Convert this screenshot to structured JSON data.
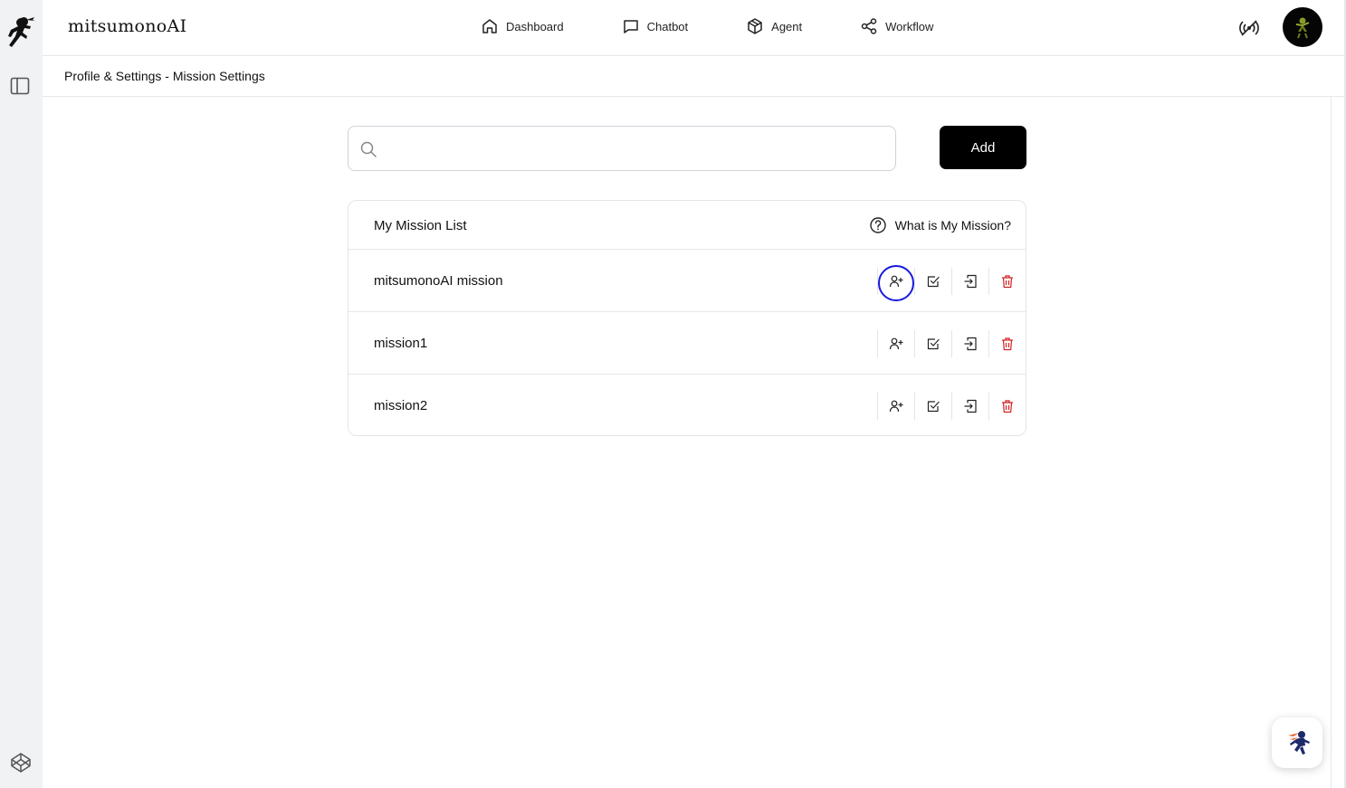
{
  "app": {
    "brand": "mitsumonoAI"
  },
  "nav": {
    "items": [
      {
        "label": "Dashboard",
        "icon": "home-icon"
      },
      {
        "label": "Chatbot",
        "icon": "chat-bubble-icon"
      },
      {
        "label": "Agent",
        "icon": "cube-icon"
      },
      {
        "label": "Workflow",
        "icon": "share-nodes-icon"
      }
    ]
  },
  "breadcrumb": {
    "text": "Profile & Settings - Mission Settings"
  },
  "search": {
    "value": "",
    "placeholder": ""
  },
  "toolbar": {
    "add_label": "Add"
  },
  "mission_list": {
    "title": "My Mission List",
    "help_label": "What is My Mission?",
    "rows": [
      {
        "name": "mitsumonoAI mission"
      },
      {
        "name": "mission1"
      },
      {
        "name": "mission2"
      }
    ],
    "actions": [
      "add-user-icon",
      "check-square-icon",
      "sign-in-icon",
      "trash-icon"
    ]
  },
  "colors": {
    "accent": "#000000",
    "danger": "#d11f1f",
    "highlight": "#1a1ae0",
    "rail": "#f1f2f4"
  }
}
